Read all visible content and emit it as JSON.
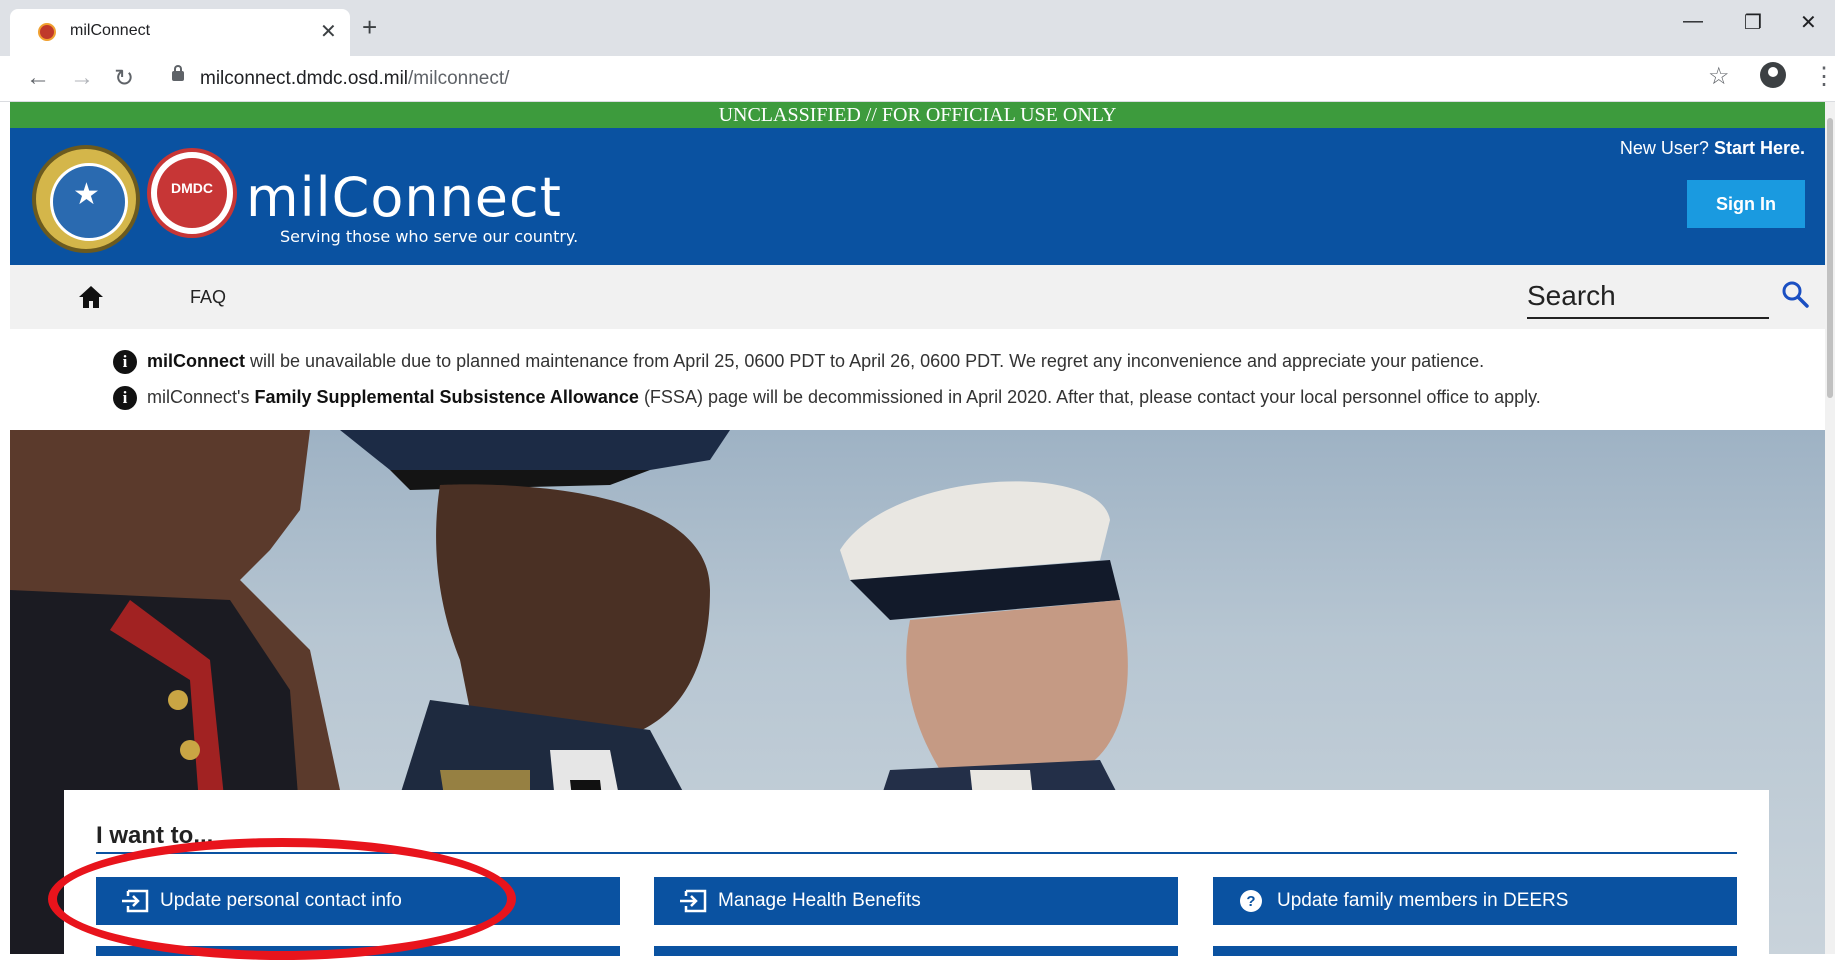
{
  "browser": {
    "tab_title": "milConnect",
    "url_host": "milconnect.dmdc.osd.mil",
    "url_path": "/milconnect/"
  },
  "banner": {
    "classification": "UNCLASSIFIED // FOR OFFICIAL USE ONLY"
  },
  "header": {
    "site_title": "milConnect",
    "tagline": "Serving those who serve our country.",
    "new_user_prefix": "New User?",
    "new_user_link": "Start Here.",
    "sign_in": "Sign In",
    "seal2_text": "DMDC"
  },
  "nav": {
    "faq": "FAQ",
    "search_placeholder": "Search"
  },
  "notices": [
    {
      "bold": "milConnect",
      "text": " will be unavailable due to planned maintenance from April 25, 0600 PDT to April 26, 0600 PDT. We regret any inconvenience and appreciate your patience."
    },
    {
      "prefix": "milConnect's ",
      "bold": "Family Supplemental Subsistence Allowance",
      "text": " (FSSA) page will be decommissioned in April 2020. After that, please contact your local personnel office to apply."
    }
  ],
  "i_want_to": {
    "title": "I want to...",
    "actions": [
      {
        "label": "Update personal contact info",
        "icon": "sign-in-icon"
      },
      {
        "label": "Manage Health Benefits",
        "icon": "sign-in-icon"
      },
      {
        "label": "Update family members in DEERS",
        "icon": "help-circle-icon"
      }
    ]
  },
  "colors": {
    "header_blue": "#0a52a1",
    "classification_green": "#3d9b3d",
    "sign_in_blue": "#1a9ae0",
    "annotation_red": "#e8141c"
  }
}
